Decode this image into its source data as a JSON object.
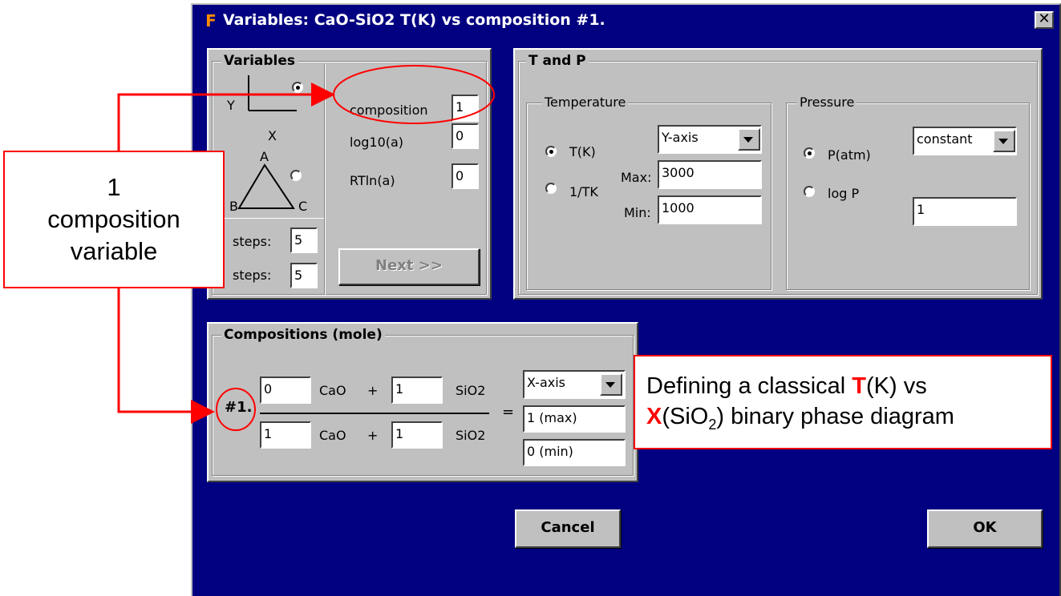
{
  "window": {
    "title": "Variables:  CaO-SiO2  T(K) vs composition #1.",
    "app_icon": "F",
    "close_glyph": "✕"
  },
  "variables_group": {
    "title": "Variables",
    "axes_y": "Y",
    "axes_x": "X",
    "tri_a": "A",
    "tri_b": "B",
    "tri_c": "C",
    "steps_label": "steps:",
    "steps1": "5",
    "steps2": "5",
    "composition_label": "composition",
    "composition_value": "1",
    "log_label": "log10(a)",
    "log_value": "0",
    "rtln_label": "RTln(a)",
    "rtln_value": "0",
    "next_label": "Next >>"
  },
  "tp_group": {
    "title": "T and P",
    "temp_title": "Temperature",
    "tk_label": "T(K)",
    "inv_label": "1/TK",
    "t_axis_value": "Y-axis",
    "max_label": "Max:",
    "max_value": "3000",
    "min_label": "Min:",
    "min_value": "1000",
    "pres_title": "Pressure",
    "patm_label": "P(atm)",
    "logp_label": "log P",
    "p_mode_value": "constant",
    "p_value": "1"
  },
  "comp_group": {
    "title": "Compositions (mole)",
    "row_label": "#1.",
    "num_cao": "0",
    "num_sio2": "1",
    "den_cao": "1",
    "den_sio2": "1",
    "cao": "CaO",
    "sio2": "SiO2",
    "plus": "+",
    "equals": "=",
    "axis_value": "X-axis",
    "max_value": "1 (max)",
    "min_value": "0 (min)"
  },
  "buttons": {
    "cancel": "Cancel",
    "ok": "OK"
  },
  "callouts": {
    "left_line1": "1",
    "left_line2": "composition",
    "left_line3": "variable",
    "right_line1_pre": "Defining a classical ",
    "right_line1_T": "T",
    "right_line1_post": "(K) vs",
    "right_line2_X": "X",
    "right_line2_a": "(SiO",
    "right_line2_sub": "2",
    "right_line2_b": ") binary phase diagram"
  },
  "colors": {
    "window_bg": "#000080",
    "panel_bg": "#c0c0c0",
    "annotation": "#ff0000"
  }
}
